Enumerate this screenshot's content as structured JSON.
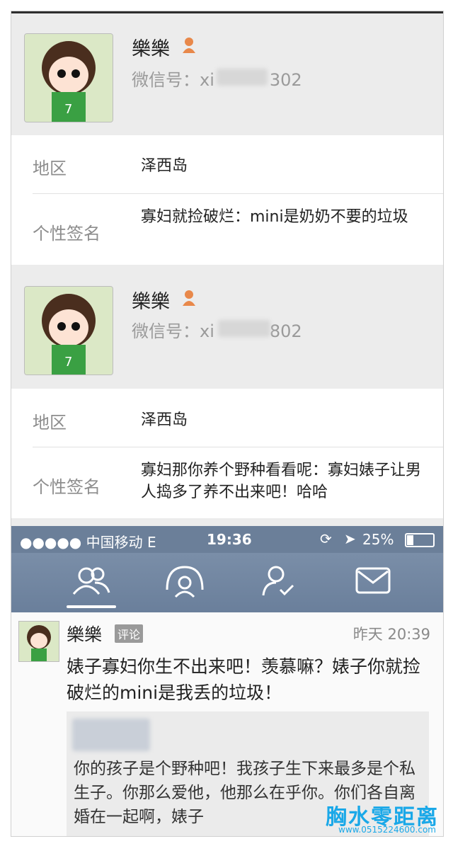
{
  "profiles": [
    {
      "name": "樂樂",
      "wechat_label": "微信号：",
      "wechat_prefix": "xi",
      "wechat_suffix": "302",
      "region_label": "地区",
      "region_value": "泽西岛",
      "signature_label": "个性签名",
      "signature_value": "寡妇就捡破烂：mini是奶奶不要的垃圾"
    },
    {
      "name": "樂樂",
      "wechat_label": "微信号：",
      "wechat_prefix": "xi",
      "wechat_suffix": "802",
      "region_label": "地区",
      "region_value": "泽西岛",
      "signature_label": "个性签名",
      "signature_value": "寡妇那你养个野种看看呢：寡妇婊子让男人捣多了养不出来吧！哈哈"
    }
  ],
  "statusbar": {
    "signal": "●●●●● 中国移动  E",
    "time": "19:36",
    "battery": "25%"
  },
  "tabs": [
    "friends-icon",
    "circle-icon",
    "contact-check-icon",
    "mail-icon"
  ],
  "post": {
    "author": "樂樂",
    "tag": "评论",
    "time": "昨天 20:39",
    "body": "婊子寡妇你生不出来吧！羡慕嘛？婊子你就捡破烂的mini是我丢的垃圾！",
    "quote": "你的孩子是个野种吧！我孩子生下来最多是个私生子。你那么爱他，他那么在乎你。你们各自离婚在一起啊，婊子",
    "watermark": "胸水零距离",
    "watermark_url": "www.0515224600.com"
  },
  "colors": {
    "card_bg": "#ececec",
    "statusbar_bg": "#6b7f99",
    "watermark": "#1aa8e8",
    "female_icon": "#e8884a"
  }
}
